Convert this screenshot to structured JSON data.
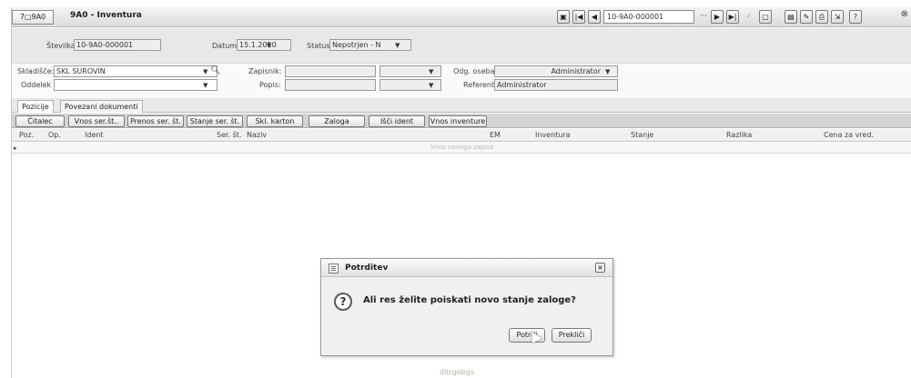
{
  "window": {
    "code_badge": "7▢9A0",
    "app_code": "9A0",
    "title": "9A0 - Inventura"
  },
  "nav": {
    "record_field": "10-9A0-000001",
    "ellipsis": "···"
  },
  "header": {
    "stevilka_label": "Številka",
    "stevilka_value": "10-9A0-000001",
    "datum_label": "Datum",
    "datum_value": "15.1.2010",
    "status_label": "Status",
    "status_value": "Nepotrjen - N"
  },
  "form": {
    "skladisce_label": "Skladišče:",
    "skladisce_value": "SKL SUROVIN",
    "oddelek_label": "Oddelek",
    "oddelek_value": "",
    "zapisnik_label": "Zapisnik:",
    "zapisnik_value": "",
    "popis_label": "Popis:",
    "popis_value": "",
    "odg_oseba_label": "Odg. oseba",
    "odg_oseba_value": "Administrator",
    "referent_label": "Referent",
    "referent_value": "Administrator"
  },
  "tabs": [
    {
      "label": "Pozicije"
    },
    {
      "label": "Povezani dokumenti"
    }
  ],
  "toolbar": {
    "buttons": [
      "Čitalec",
      "Vnos ser.št..",
      "Prenos ser. št.",
      "Stanje ser. št.",
      "Skl. karton",
      "Zaloga",
      "Išči ident",
      "Vnos inventure"
    ]
  },
  "table": {
    "headers": [
      "Poz.",
      "Op.",
      "Ident",
      "Ser. št.",
      "Naziv",
      "EM",
      "Inventura",
      "Stanje",
      "Razlika",
      "Cena za vred."
    ],
    "new_row_hint": "Vnos novega zapisa"
  },
  "footer_hint": "dlisgobgs",
  "dialog": {
    "title": "Potrditev",
    "message": "Ali res želite poiskati novo stanje zaloge?",
    "ok_label": "Potrdi",
    "cancel_label": "Prekliči"
  },
  "colors": {
    "window_bg": "#ffffff",
    "panel_grey": "#e8e8e8",
    "button_bar": "#d4d4d4",
    "dialog_bg": "#f0f0f0"
  }
}
